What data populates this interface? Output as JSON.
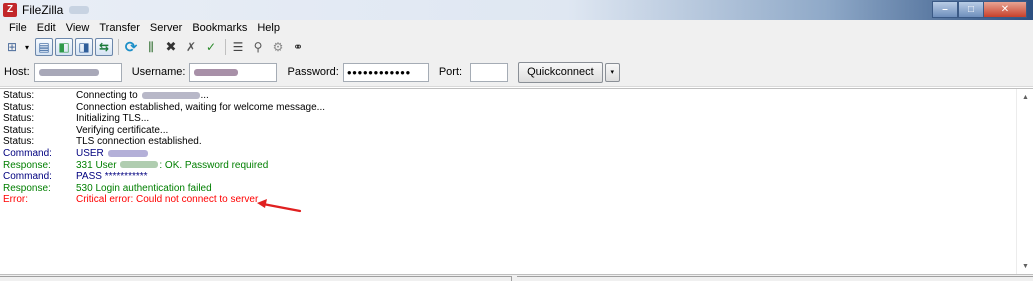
{
  "window": {
    "title": "FileZilla",
    "app_icon": "Z",
    "controls": {
      "minimize": "–",
      "maximize": "□",
      "close": "✕"
    }
  },
  "menu": {
    "items": [
      "File",
      "Edit",
      "View",
      "Transfer",
      "Server",
      "Bookmarks",
      "Help"
    ]
  },
  "toolbar": {
    "icons": [
      "site-manager-icon",
      "toggle-message-log-icon",
      "toggle-local-tree-icon",
      "toggle-remote-tree-icon",
      "toggle-transfer-queue-icon",
      "refresh-icon",
      "process-queue-icon",
      "cancel-icon",
      "disconnect-icon",
      "reconnect-icon",
      "directory-filter-icon",
      "toggle-comparison-icon",
      "sync-browsing-icon",
      "search-icon"
    ],
    "glyphs": {
      "site_manager": "⊞",
      "dropdown": "▾",
      "message_log": "▤",
      "local_tree": "◧",
      "remote_tree": "◨",
      "transfer_queue": "⇆",
      "refresh": "⟳",
      "process_queue": "⫼",
      "cancel": "✖",
      "disconnect": "✗",
      "reconnect": "✓",
      "filter": "☰",
      "compare": "⚲",
      "sync": "⚙",
      "search": "⚭"
    }
  },
  "quickconnect": {
    "host_label": "Host:",
    "username_label": "Username:",
    "password_label": "Password:",
    "password_value": "●●●●●●●●●●●●",
    "port_label": "Port:",
    "port_value": "",
    "button_label": "Quickconnect",
    "dropdown_glyph": "▾"
  },
  "log": {
    "entries": [
      {
        "type": "Status:",
        "kind": "status",
        "text": "Connecting to",
        "after": "..."
      },
      {
        "type": "Status:",
        "kind": "status",
        "text": "Connection established, waiting for welcome message...",
        "after": ""
      },
      {
        "type": "Status:",
        "kind": "status",
        "text": "Initializing TLS...",
        "after": ""
      },
      {
        "type": "Status:",
        "kind": "status",
        "text": "Verifying certificate...",
        "after": ""
      },
      {
        "type": "Status:",
        "kind": "status",
        "text": "TLS connection established.",
        "after": ""
      },
      {
        "type": "Command:",
        "kind": "command",
        "text": "USER",
        "after": ""
      },
      {
        "type": "Response:",
        "kind": "response",
        "text": "331 User",
        "after": ": OK. Password required"
      },
      {
        "type": "Command:",
        "kind": "command",
        "text": "PASS ***********",
        "after": ""
      },
      {
        "type": "Response:",
        "kind": "response",
        "text": "530 Login authentication failed",
        "after": ""
      },
      {
        "type": "Error:",
        "kind": "error",
        "text": "Critical error: Could not connect to server",
        "after": ""
      }
    ],
    "scroll_up": "▲",
    "scroll_down": "▼"
  },
  "colors": {
    "status": "#000000",
    "command": "#00007f",
    "response": "#007f00",
    "error": "#ff0000",
    "annotation_arrow": "#e02020"
  }
}
